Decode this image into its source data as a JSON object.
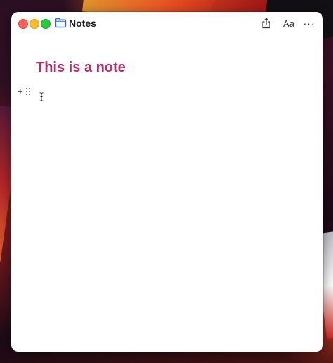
{
  "window": {
    "title": "Notes",
    "folder_icon": "folder-icon",
    "traffic_lights": [
      "close",
      "minimize",
      "zoom"
    ],
    "colors": {
      "close": "#ff5f57",
      "minimize": "#febc2e",
      "zoom": "#28c840",
      "folder": "#2b6fd6"
    }
  },
  "toolbar": {
    "share_icon": "share-icon",
    "font_label": "Aa",
    "more_label": "···"
  },
  "editor": {
    "title": "This is a note",
    "title_color": "#b0306a",
    "add_block_label": "+",
    "drag_handle_icon": "drag-handle-icon",
    "cursor_icon": "text-cursor-icon"
  }
}
